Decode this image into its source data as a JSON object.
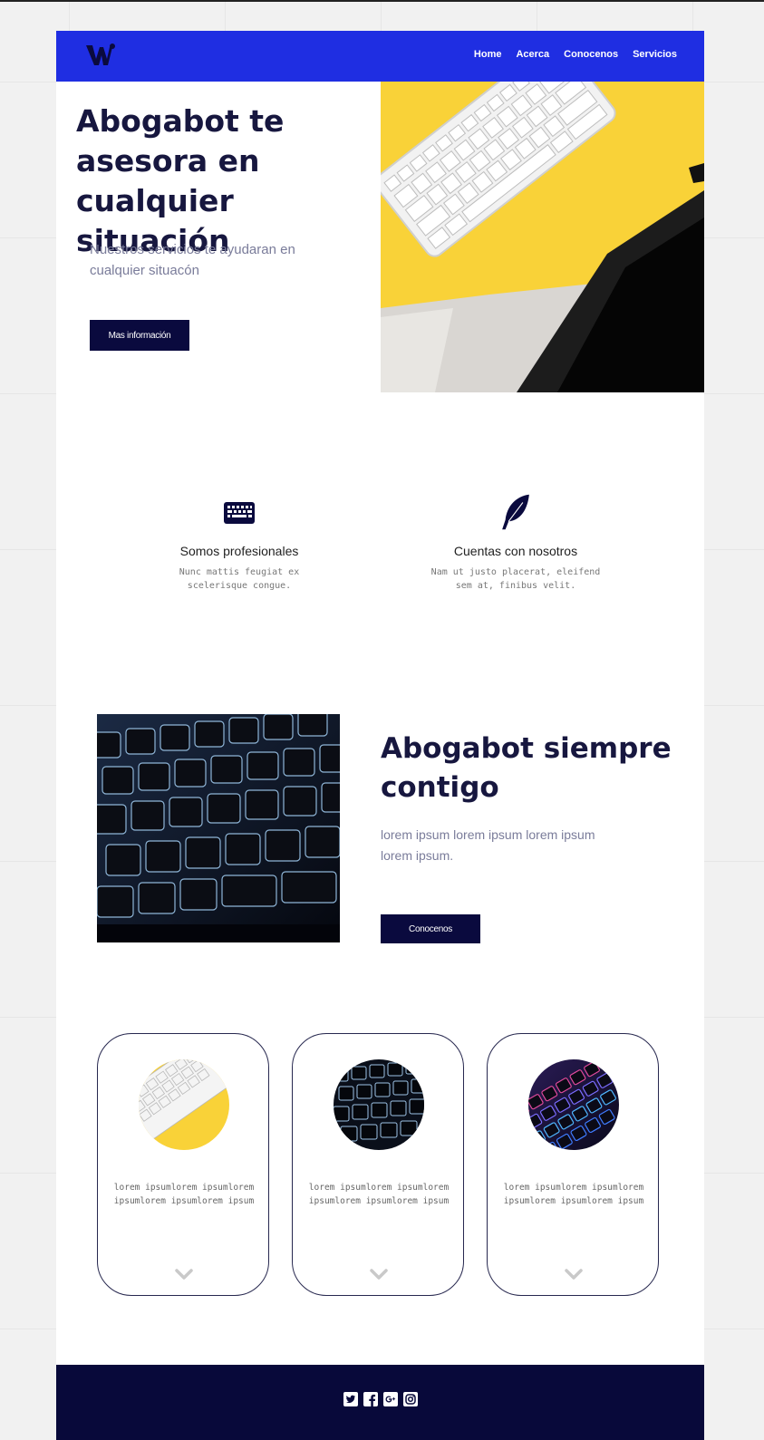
{
  "nav": {
    "links": [
      "Home",
      "Acerca",
      "Conocenos",
      "Servicios"
    ]
  },
  "hero": {
    "title": "Abogabot te asesora en cualquier situación",
    "subtitle": "Nuestros servicios te ayudaran en cualquier situacón",
    "button_label": "Mas información"
  },
  "features": [
    {
      "icon": "keyboard-icon",
      "title": "Somos profesionales",
      "description": "Nunc mattis feugiat ex scelerisque congue."
    },
    {
      "icon": "feather-icon",
      "title": "Cuentas con nosotros",
      "description": "Nam ut justo placerat, eleifend sem at, finibus velit."
    }
  ],
  "section2": {
    "title": "Abogabot siempre contigo",
    "text": "lorem ipsum lorem ipsum lorem ipsum lorem ipsum.",
    "button_label": "Conocenos"
  },
  "cards": [
    {
      "text": "lorem ipsumlorem ipsumlorem ipsumlorem ipsumlorem ipsum"
    },
    {
      "text": "lorem ipsumlorem ipsumlorem ipsumlorem ipsumlorem ipsum"
    },
    {
      "text": "lorem ipsumlorem ipsumlorem ipsumlorem ipsumlorem ipsum"
    }
  ],
  "footer": {
    "social_icons": [
      "twitter-icon",
      "facebook-icon",
      "google-plus-icon",
      "instagram-icon"
    ]
  },
  "colors": {
    "nav_bg": "#1f2ee2",
    "dark_navy": "#0a0a3e",
    "heading": "#17173f",
    "accent_yellow": "#f9d238"
  }
}
